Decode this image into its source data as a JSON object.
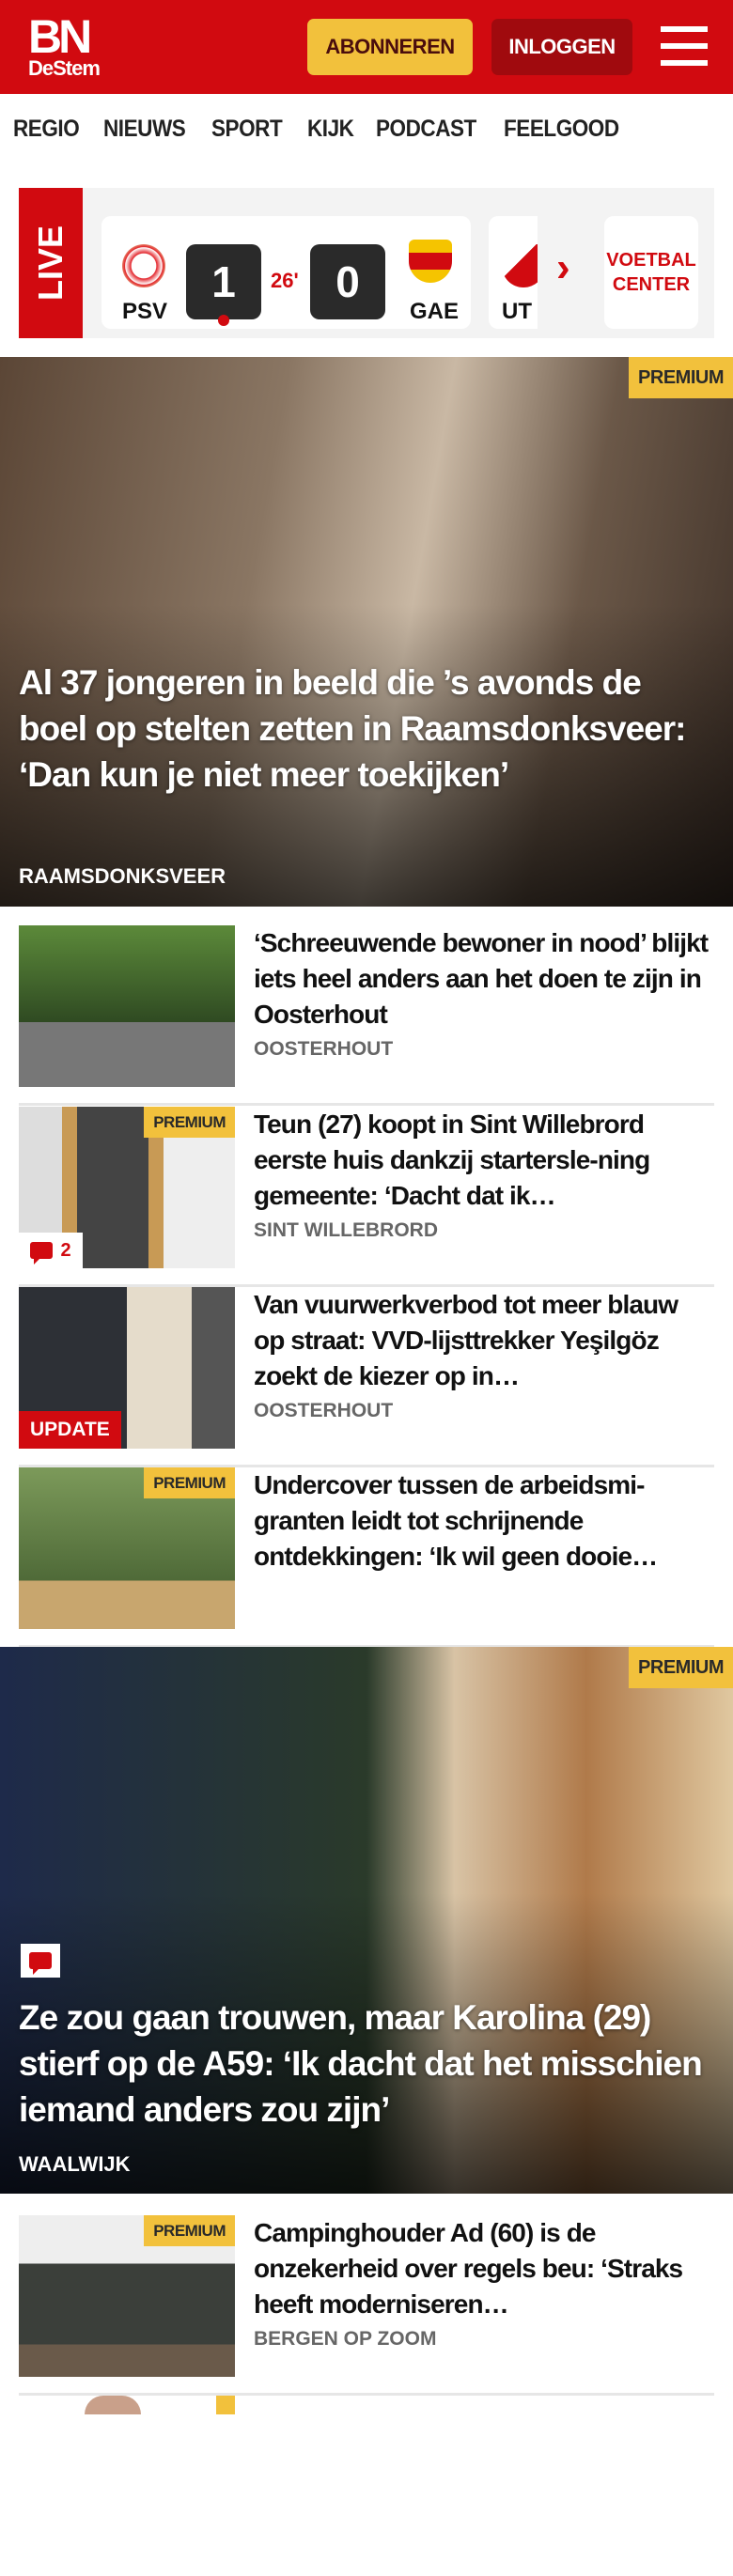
{
  "header": {
    "logo_top": "BN",
    "logo_bottom": "DeStem",
    "subscribe_label": "ABONNEREN",
    "login_label": "INLOGGEN"
  },
  "nav": {
    "items": [
      "REGIO",
      "NIEUWS",
      "SPORT",
      "KIJK",
      "PODCAST",
      "FEELGOOD"
    ]
  },
  "live": {
    "label": "LIVE",
    "match": {
      "home": "PSV",
      "away": "GAE",
      "home_score": "1",
      "away_score": "0",
      "minute": "26'"
    },
    "next_team": "UT",
    "center_label_1": "VOETBAL",
    "center_label_2": "CENTER"
  },
  "hero1": {
    "badge": "PREMIUM",
    "title": "Al 37 jongeren in beeld die ’s avonds de boel op stelten zetten in Raamsdonksveer: ‘Dan kun je niet meer toekijken’",
    "location": "RAAMSDONKSVEER"
  },
  "articles": [
    {
      "title": "‘Schreeuwende bewoner in nood’ blijkt iets heel anders aan het doen te zijn in Oosterhout",
      "location": "OOSTERHOUT"
    },
    {
      "badge": "PREMIUM",
      "title": "Teun (27) koopt in Sint Willebrord eerste huis dankzij startersle-ning gemeente: ‘Dacht dat ik…",
      "location": "SINT WILLEBRORD",
      "comments": "2"
    },
    {
      "tag": "UPDATE",
      "title": "Van vuurwerkverbod tot meer blauw op straat: VVD-lijsttrekker Yeşilgöz zoekt de kiezer op in…",
      "location": "OOSTERHOUT"
    },
    {
      "badge": "PREMIUM",
      "title": "Undercover tussen de arbeidsmi-granten leidt tot schrijnende ontdekkingen: ‘Ik wil geen dooie…",
      "location": ""
    }
  ],
  "hero2": {
    "badge": "PREMIUM",
    "title": "Ze zou gaan trouwen, maar Karolina (29) stierf op de A59: ‘Ik dacht dat het misschien iemand anders zou zijn’",
    "location": "WAALWIJK"
  },
  "article5": {
    "badge": "PREMIUM",
    "title": "Campinghouder Ad (60) is de onzekerheid over regels beu: ‘Straks heeft moderniseren…",
    "location": "BERGEN OP ZOOM"
  },
  "colors": {
    "brand": "#d10a10",
    "premium": "#f2c13c"
  }
}
